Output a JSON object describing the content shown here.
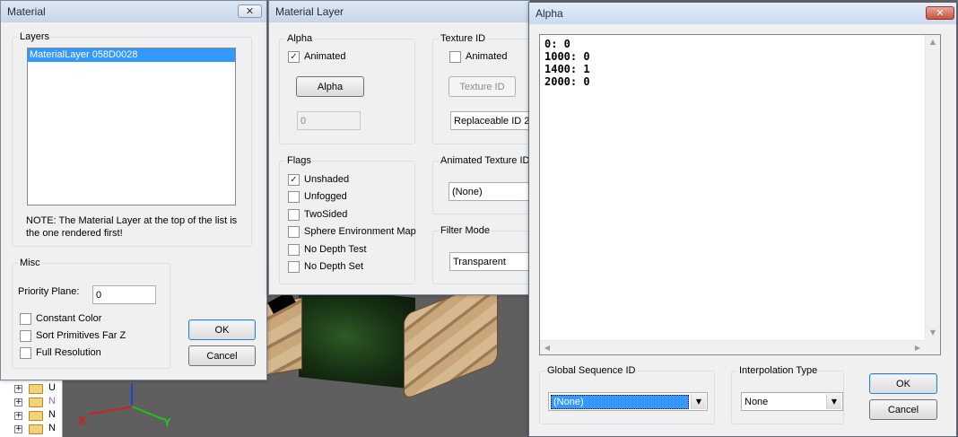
{
  "tree": {
    "rows": [
      {
        "label": "U"
      },
      {
        "label": "N"
      },
      {
        "label": "N"
      },
      {
        "label": "N"
      }
    ]
  },
  "scene": {
    "axis_x_label": "X",
    "axis_y_label": "Y"
  },
  "material_window": {
    "title": "Material",
    "close_glyph": "✕",
    "layers": {
      "group_label": "Layers",
      "items": [
        "MaterialLayer 058D0028"
      ],
      "note": "NOTE: The Material Layer at the top of the list is the one rendered first!"
    },
    "misc": {
      "group_label": "Misc",
      "priority_label": "Priority Plane:",
      "priority_value": "0",
      "checkboxes": [
        {
          "label": "Constant Color",
          "checked": false
        },
        {
          "label": "Sort Primitives Far Z",
          "checked": false
        },
        {
          "label": "Full Resolution",
          "checked": false
        }
      ]
    },
    "ok_label": "OK",
    "cancel_label": "Cancel"
  },
  "layer_window": {
    "title": "Material Layer",
    "alpha": {
      "group_label": "Alpha",
      "animated_label": "Animated",
      "animated_checked": true,
      "button_label": "Alpha",
      "value": "0"
    },
    "texture_id": {
      "group_label": "Texture ID",
      "animated_label": "Animated",
      "animated_checked": false,
      "button_label": "Texture ID",
      "selected": "Replaceable ID 2"
    },
    "flags": {
      "group_label": "Flags",
      "items": [
        {
          "label": "Unshaded",
          "checked": true
        },
        {
          "label": "Unfogged",
          "checked": false
        },
        {
          "label": "TwoSided",
          "checked": false
        },
        {
          "label": "Sphere Environment Map",
          "checked": false
        },
        {
          "label": "No Depth Test",
          "checked": false
        },
        {
          "label": "No Depth Set",
          "checked": false
        }
      ]
    },
    "animated_texture_id": {
      "group_label": "Animated Texture ID",
      "selected": "(None)"
    },
    "filter_mode": {
      "group_label": "Filter Mode",
      "selected": "Transparent"
    }
  },
  "alpha_window": {
    "title": "Alpha",
    "close_glyph": "✕",
    "keyframes": [
      "0: 0",
      "1000: 0",
      "1400: 1",
      "2000: 0"
    ],
    "global_sequence": {
      "group_label": "Global Sequence ID",
      "selected": "(None)"
    },
    "interpolation": {
      "group_label": "Interpolation Type",
      "selected": "None"
    },
    "ok_label": "OK",
    "cancel_label": "Cancel"
  },
  "colors": {
    "selection": "#3399ff",
    "axis_x": "#d02020",
    "axis_y": "#20c020",
    "axis_z": "#2040d0"
  }
}
